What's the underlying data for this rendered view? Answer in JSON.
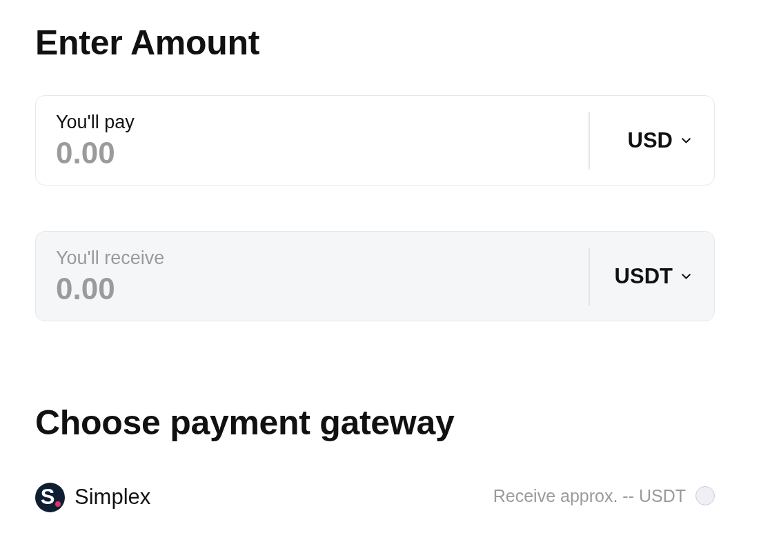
{
  "amount_section": {
    "heading": "Enter Amount",
    "fields": [
      {
        "label": "You'll pay",
        "placeholder": "0.00",
        "disabled": false,
        "currency": "USD"
      },
      {
        "label": "You'll receive",
        "placeholder": "0.00",
        "disabled": true,
        "currency": "USDT"
      }
    ]
  },
  "gateway_section": {
    "heading": "Choose payment gateway",
    "gateways": [
      {
        "name": "Simplex",
        "logo_letter": "S",
        "note": "Receive approx. -- USDT",
        "selected": false
      }
    ]
  }
}
